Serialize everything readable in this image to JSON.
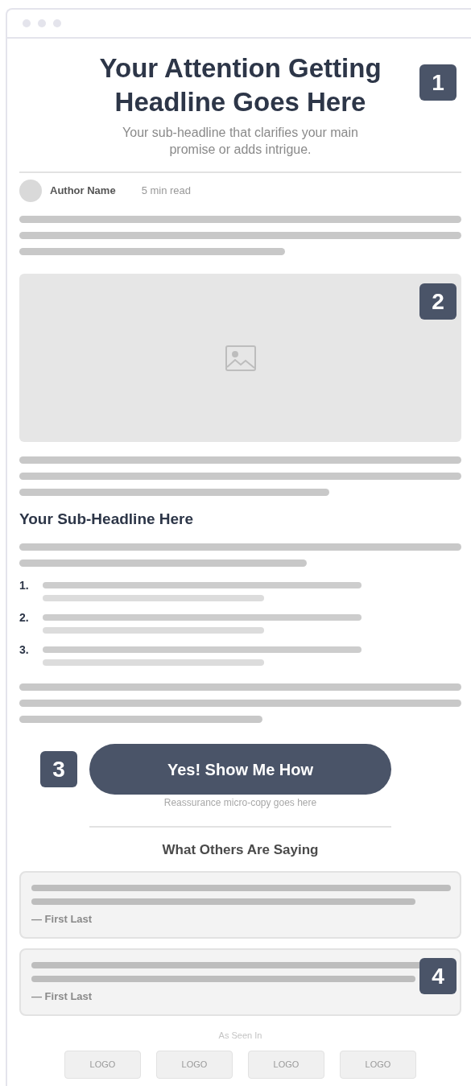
{
  "headline": "Your Attention Getting Headline Goes Here",
  "subheadline": "Your sub-headline that clarifies your main promise or adds intrigue.",
  "author": {
    "name": "Author Name",
    "read_time": "5 min read"
  },
  "section_heading": "Your Sub-Headline Here",
  "numbered_list": [
    {
      "number": "1."
    },
    {
      "number": "2."
    },
    {
      "number": "3."
    }
  ],
  "cta": {
    "label": "Yes! Show Me How",
    "note": "Reassurance micro-copy goes here"
  },
  "testimonials": {
    "title": "What Others Are Saying",
    "items": [
      {
        "author": "— First Last"
      },
      {
        "author": "— First Last"
      }
    ]
  },
  "as_seen_in": {
    "label": "As Seen In",
    "logos": [
      "LOGO",
      "LOGO",
      "LOGO",
      "LOGO"
    ]
  },
  "annotations": [
    "1",
    "2",
    "3",
    "4"
  ]
}
